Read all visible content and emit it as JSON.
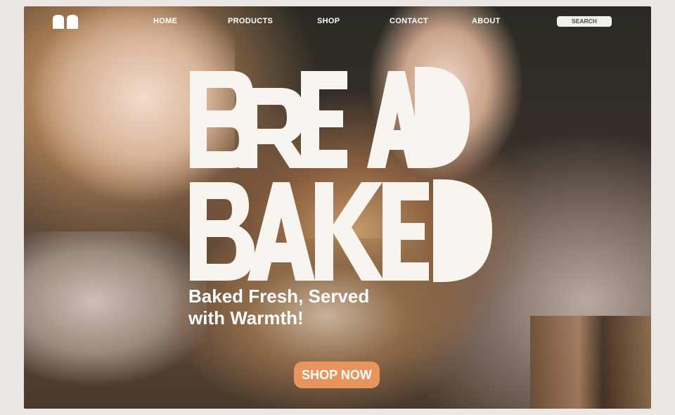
{
  "nav": {
    "items": [
      "HOME",
      "PRODUCTS",
      "SHOP",
      "CONTACT",
      "ABOUT"
    ],
    "search_label": "SEARCH"
  },
  "hero": {
    "headline_line1": "BREAD",
    "headline_line2": "BAKED",
    "tagline_line1": "Baked Fresh, Served",
    "tagline_line2": "with Warmth!",
    "cta_label": "SHOP NOW"
  },
  "colors": {
    "headline": "#f8f4ef",
    "cta": "#e8945e",
    "search_bg": "#f2f0ee"
  },
  "icons": {
    "logo": "book-logo-icon"
  }
}
